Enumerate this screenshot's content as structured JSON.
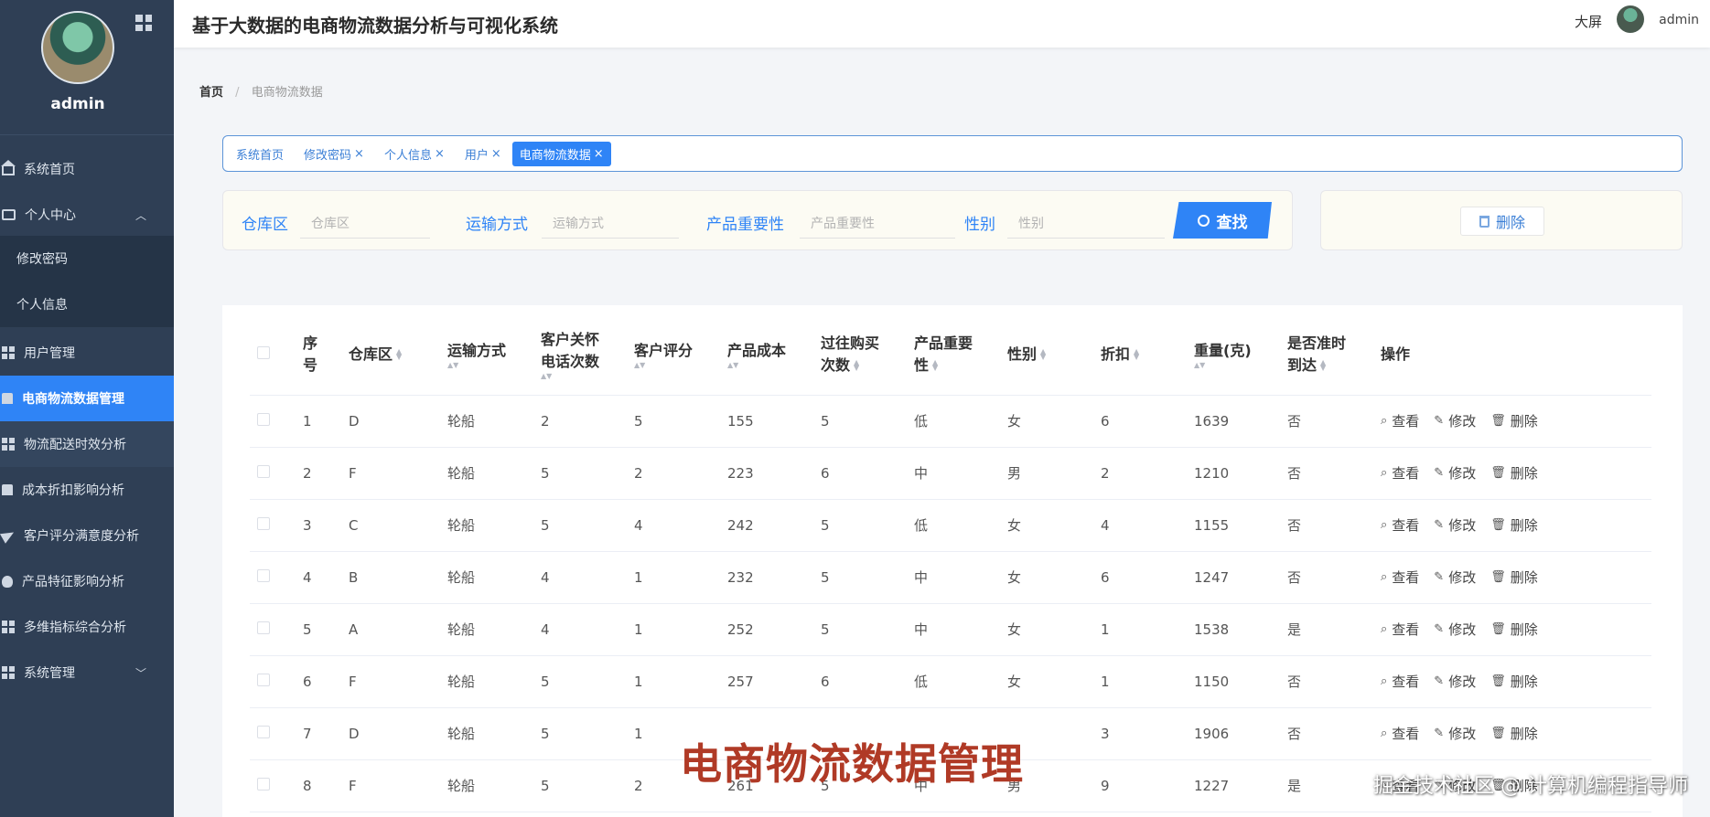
{
  "profile": {
    "name": "admin"
  },
  "header": {
    "title": "基于大数据的电商物流数据分析与可视化系统",
    "big_screen": "大屏",
    "user": "admin"
  },
  "sidebar": {
    "items": [
      {
        "label": "系统首页",
        "icon": "home-icon"
      },
      {
        "label": "个人中心",
        "icon": "box-icon",
        "expanded": true
      },
      {
        "label": "修改密码",
        "sub": true
      },
      {
        "label": "个人信息",
        "sub": true
      },
      {
        "label": "用户管理",
        "icon": "grid-icon"
      },
      {
        "label": "电商物流数据管理",
        "icon": "doc-icon",
        "active": true
      },
      {
        "label": "物流配送时效分析",
        "icon": "grid-icon"
      },
      {
        "label": "成本折扣影响分析",
        "icon": "doc-icon"
      },
      {
        "label": "客户评分满意度分析",
        "icon": "plane-icon"
      },
      {
        "label": "产品特征影响分析",
        "icon": "bulb-icon"
      },
      {
        "label": "多维指标综合分析",
        "icon": "grid-icon"
      },
      {
        "label": "系统管理",
        "icon": "grid-icon"
      }
    ]
  },
  "breadcrumb": {
    "home": "首页",
    "current": "电商物流数据"
  },
  "tags": [
    {
      "label": "系统首页",
      "closable": false
    },
    {
      "label": "修改密码",
      "closable": true
    },
    {
      "label": "个人信息",
      "closable": true
    },
    {
      "label": "用户",
      "closable": true
    },
    {
      "label": "电商物流数据",
      "closable": true,
      "active": true
    }
  ],
  "close_glyph": "×",
  "search": {
    "fields": [
      {
        "label": "仓库区",
        "placeholder": "仓库区"
      },
      {
        "label": "运输方式",
        "placeholder": "运输方式"
      },
      {
        "label": "产品重要性",
        "placeholder": "产品重要性"
      },
      {
        "label": "性别",
        "placeholder": "性别"
      }
    ],
    "button": "查找"
  },
  "actions": {
    "delete": "删除"
  },
  "table": {
    "headers": {
      "index": [
        "序",
        "号"
      ],
      "warehouse": "仓库区",
      "shipment": "运输方式",
      "care_calls": [
        "客户关怀",
        "电话次数"
      ],
      "rating": "客户评分",
      "cost": "产品成本",
      "purchases": [
        "过往购买",
        "次数"
      ],
      "importance": [
        "产品重要",
        "性"
      ],
      "gender": "性别",
      "discount": "折扣",
      "weight": "重量(克)",
      "on_time": [
        "是否准时",
        "到达"
      ],
      "ops": "操作"
    },
    "op_labels": {
      "view": "查看",
      "edit": "修改",
      "delete": "删除"
    },
    "rows": [
      [
        "1",
        "D",
        "轮船",
        "2",
        "5",
        "155",
        "5",
        "低",
        "女",
        "6",
        "1639",
        "否"
      ],
      [
        "2",
        "F",
        "轮船",
        "5",
        "2",
        "223",
        "6",
        "中",
        "男",
        "2",
        "1210",
        "否"
      ],
      [
        "3",
        "C",
        "轮船",
        "5",
        "4",
        "242",
        "5",
        "低",
        "女",
        "4",
        "1155",
        "否"
      ],
      [
        "4",
        "B",
        "轮船",
        "4",
        "1",
        "232",
        "5",
        "中",
        "女",
        "6",
        "1247",
        "否"
      ],
      [
        "5",
        "A",
        "轮船",
        "4",
        "1",
        "252",
        "5",
        "中",
        "女",
        "1",
        "1538",
        "是"
      ],
      [
        "6",
        "F",
        "轮船",
        "5",
        "1",
        "257",
        "6",
        "低",
        "女",
        "1",
        "1150",
        "否"
      ],
      [
        "7",
        "D",
        "轮船",
        "5",
        "1",
        "",
        "",
        "",
        "",
        "3",
        "1906",
        "否"
      ],
      [
        "8",
        "F",
        "轮船",
        "5",
        "2",
        "261",
        "5",
        "中",
        "男",
        "9",
        "1227",
        "是"
      ]
    ]
  },
  "overlay": {
    "title": "电商物流数据管理",
    "watermark": "掘金技术社区 @ 计算机编程指导师"
  },
  "colors": {
    "sidebar": "#2f3f55",
    "accent": "#2f84f6",
    "overlay": "#b03a26"
  }
}
